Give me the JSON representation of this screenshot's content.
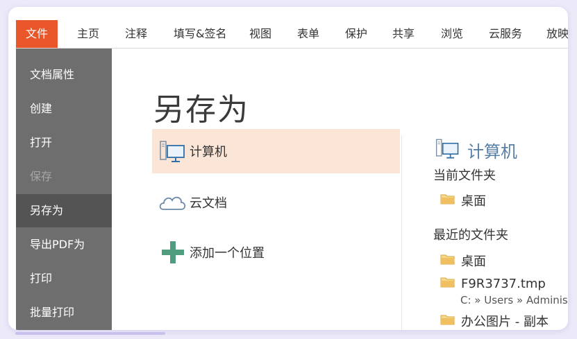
{
  "menubar": {
    "items": [
      "文件",
      "主页",
      "注释",
      "填写&签名",
      "视图",
      "表单",
      "保护",
      "共享",
      "浏览",
      "云服务",
      "放映"
    ],
    "active_index": 0
  },
  "sidebar": {
    "items": [
      {
        "label": "文档属性"
      },
      {
        "label": "创建"
      },
      {
        "label": "打开"
      },
      {
        "label": "保存",
        "disabled": true
      },
      {
        "label": "另存为",
        "selected": true
      },
      {
        "label": "导出PDF为"
      },
      {
        "label": "打印"
      },
      {
        "label": "批量打印"
      }
    ]
  },
  "main": {
    "title": "另存为",
    "options": [
      {
        "label": "计算机",
        "icon": "computer-icon",
        "selected": true
      },
      {
        "label": "云文档",
        "icon": "cloud-icon"
      },
      {
        "label": "添加一个位置",
        "icon": "plus-icon"
      }
    ]
  },
  "right_panel": {
    "header": "计算机",
    "current_folder_label": "当前文件夹",
    "current_folder": "桌面",
    "recent_label": "最近的文件夹",
    "recent": [
      {
        "name": "桌面"
      },
      {
        "name": "F9R3737.tmp",
        "path": "C: » Users » Adminis"
      },
      {
        "name": "办公图片 - 副本"
      }
    ]
  },
  "colors": {
    "accent": "#e8562a",
    "sidebar_bg": "#6e6e6e",
    "sidebar_selected": "#545454",
    "option_selected": "#fbe5d6",
    "header_blue": "#5a7fa6",
    "plus_green": "#4f9d7e",
    "folder_yellow": "#f0c060"
  }
}
